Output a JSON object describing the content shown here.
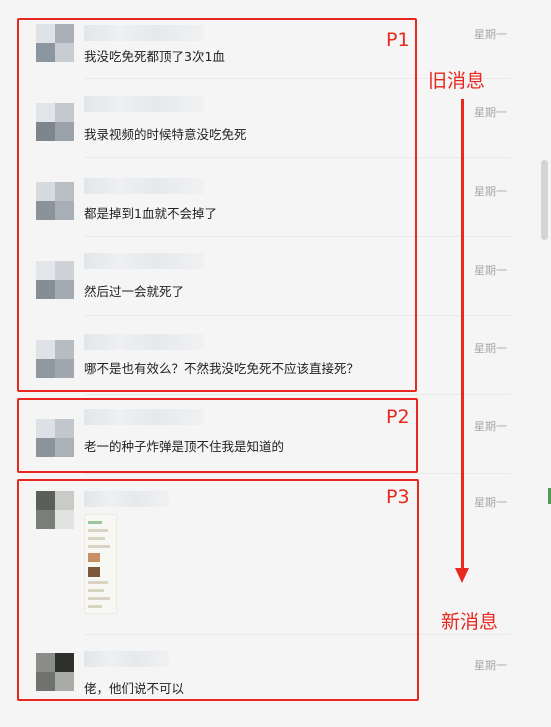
{
  "messages": [
    {
      "text": "我没吃免死都顶了3次1血",
      "time": "星期一"
    },
    {
      "text": "我录视频的时候特意没吃免死",
      "time": "星期一"
    },
    {
      "text": "都是掉到1血就不会掉了",
      "time": "星期一"
    },
    {
      "text": "然后过一会就死了",
      "time": "星期一"
    },
    {
      "text": "哪不是也有效么？不然我没吃免死不应该直接死？",
      "time": "星期一"
    },
    {
      "text": "老一的种子炸弹是顶不住我是知道的",
      "time": "星期一"
    },
    {
      "text": "",
      "time": "星期一"
    },
    {
      "text": "佬，他们说不可以",
      "time": "星期一"
    }
  ],
  "annotations": {
    "p1": "P1",
    "p2": "P2",
    "p3": "P3",
    "old": "旧消息",
    "new": "新消息"
  },
  "colors": {
    "annotation_red": "#e8281e",
    "background": "#f5f5f5",
    "time_gray": "#a8a8a8"
  }
}
